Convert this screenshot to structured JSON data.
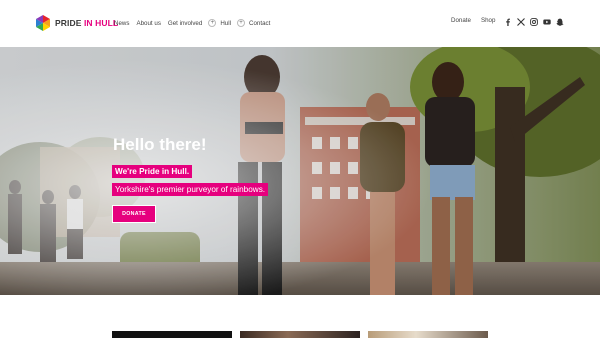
{
  "brand": {
    "name_part1": "PRIDE",
    "name_part2": "IN HULL",
    "accent": "#e6007e"
  },
  "nav": {
    "items": [
      "News",
      "About us",
      "Get involved",
      "Hull",
      "Contact"
    ],
    "expand_symbol": "+"
  },
  "utility": {
    "donate": "Donate",
    "shop": "Shop"
  },
  "social": {
    "icons": [
      "facebook-icon",
      "x-icon",
      "instagram-icon",
      "youtube-icon",
      "snapchat-icon"
    ]
  },
  "hero": {
    "title": "Hello there!",
    "tagline1": "We're Pride in Hull.",
    "tagline2": "Yorkshire's premier purveyor of rainbows.",
    "button": "DONATE"
  }
}
